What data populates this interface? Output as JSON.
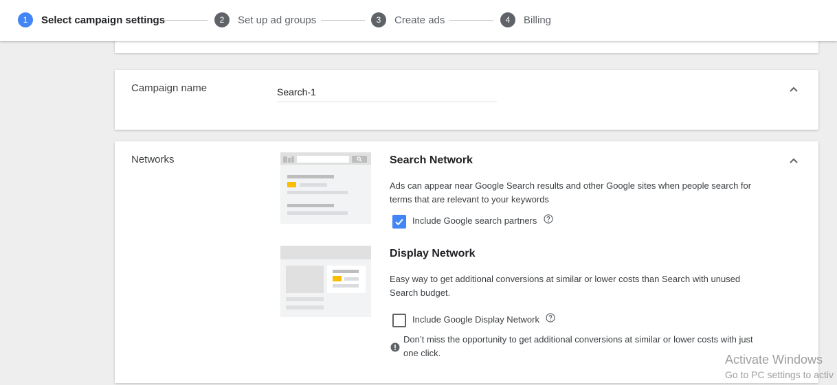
{
  "stepper": {
    "steps": [
      {
        "number": "1",
        "label": "Select campaign settings"
      },
      {
        "number": "2",
        "label": "Set up ad groups"
      },
      {
        "number": "3",
        "label": "Create ads"
      },
      {
        "number": "4",
        "label": "Billing"
      }
    ],
    "active_step": 1
  },
  "campaign_name": {
    "label": "Campaign name",
    "value": "Search-1"
  },
  "networks": {
    "label": "Networks",
    "search": {
      "title": "Search Network",
      "description": "Ads can appear near Google Search results and other Google sites when people search for terms that are relevant to your keywords",
      "checkbox_label": "Include Google search partners",
      "checked": true
    },
    "display": {
      "title": "Display Network",
      "description": "Easy way to get additional conversions at similar or lower costs than Search with unused Search budget.",
      "checkbox_label": "Include Google Display Network",
      "checked": false,
      "warning": "Don’t miss the opportunity to get additional conversions at similar or lower costs with just one click."
    }
  },
  "watermark": {
    "line1": "Activate Windows",
    "line2": "Go to PC settings to activ"
  },
  "colors": {
    "accent": "#4285f4",
    "illustration_highlight": "#fbbc04"
  },
  "icons": [
    "chevron-up-icon",
    "help-icon",
    "warning-icon",
    "check-icon",
    "search-icon"
  ]
}
